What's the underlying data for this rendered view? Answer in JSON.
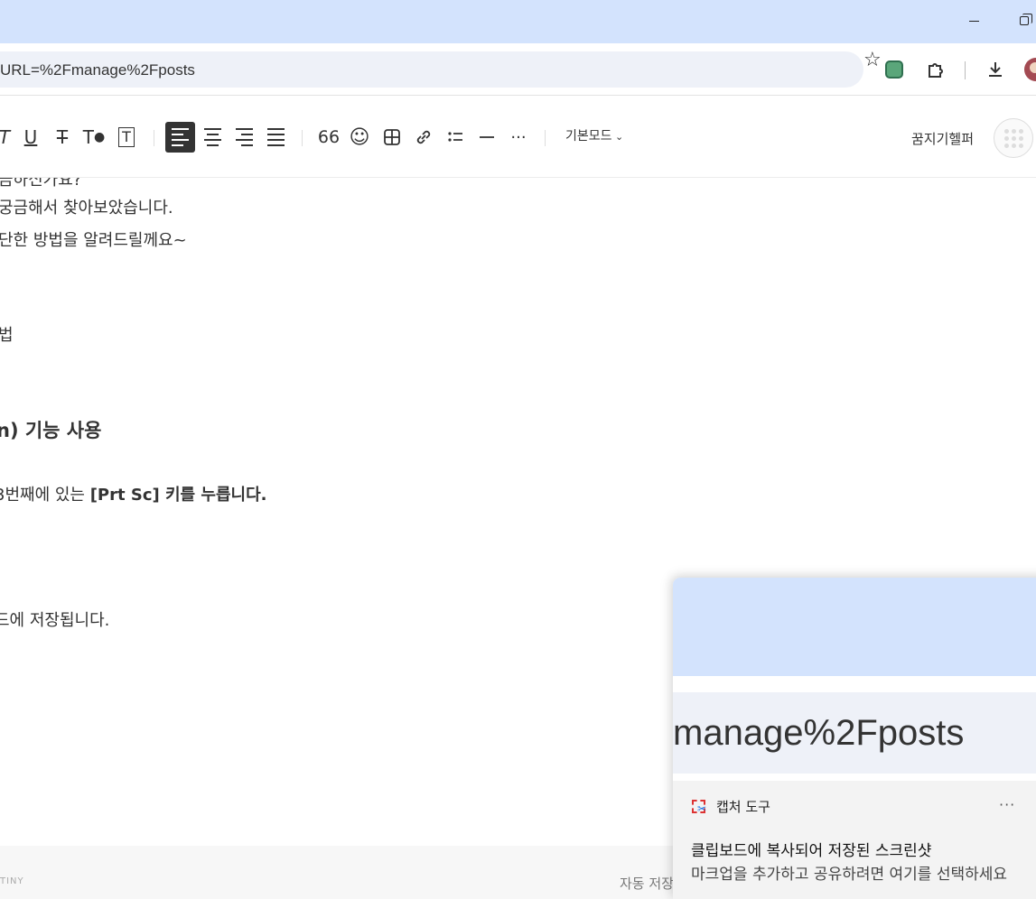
{
  "browser": {
    "url_fragment": "URL=%2Fmanage%2Fposts",
    "icons": [
      "minimize-icon",
      "restore-icon",
      "star-icon",
      "extension-icon",
      "puzzle-icon",
      "download-icon",
      "profile-avatar"
    ]
  },
  "editor_toolbar": {
    "underline": "U",
    "strikethrough": "T",
    "text_color": "T",
    "text_background": "T",
    "quote": "66",
    "emoji": "☺",
    "more": "···",
    "mode_label": "기본모드",
    "username": "꿈지기헬퍼"
  },
  "content": {
    "line_partial_top": "금하신가요?",
    "line1": "궁금해서 찾아보았습니다.",
    "line2": "단한 방법을 알려드릴께요~",
    "line3": "법",
    "heading": "n) 기능 사용",
    "line4_prefix": "3번째에 있는 ",
    "line4_bold": "[Prt Sc] 키를 누릅니다.",
    "line5": "드에 저장됩니다."
  },
  "footer": {
    "tiny_label": "TINY",
    "autosave_label": "자동 저장"
  },
  "toast": {
    "thumbnail_text": "manage%2Fposts",
    "app_name": "캡처 도구",
    "more": "···",
    "title": "클립보드에 복사되어 저장된 스크린샷",
    "subtitle": "마크업을 추가하고 공유하려면 여기를 선택하세요"
  },
  "colors": {
    "titlebar": "#d3e3fd",
    "omnibox": "#eef1f8",
    "active_align": "#333333"
  }
}
